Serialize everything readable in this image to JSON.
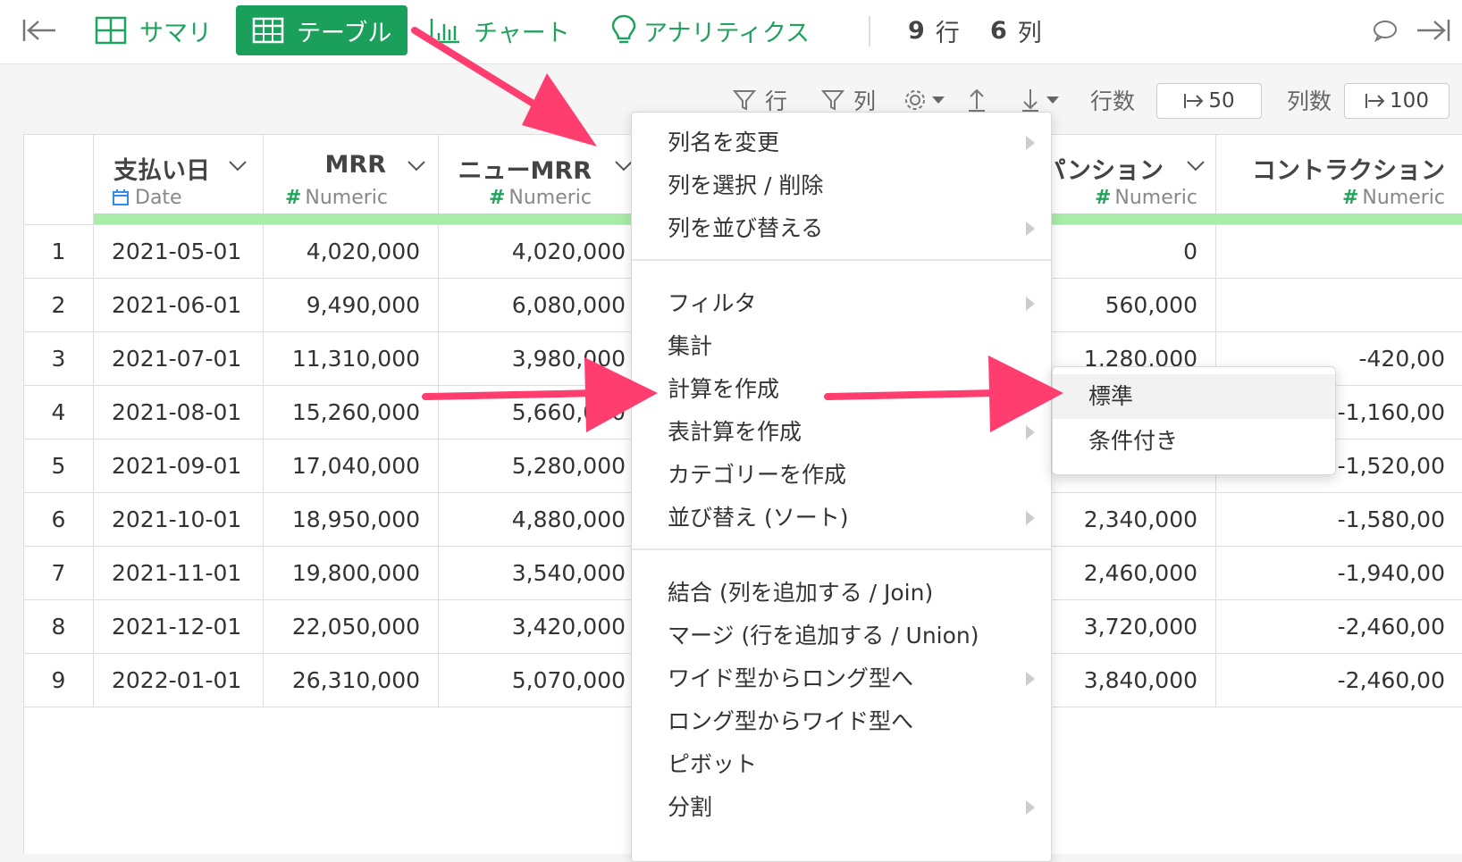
{
  "topbar": {
    "tabs": [
      {
        "label": "サマリ",
        "icon": "grid-icon"
      },
      {
        "label": "テーブル",
        "icon": "table-icon",
        "active": true
      },
      {
        "label": "チャート",
        "icon": "bar-chart-icon"
      },
      {
        "label": "アナリティクス",
        "icon": "lightbulb-icon"
      }
    ],
    "rows_count": "9",
    "rows_label": "行",
    "cols_count": "6",
    "cols_label": "列"
  },
  "toolbar": {
    "filter_rows": "行",
    "filter_cols": "列",
    "rows_label": "行数",
    "rows_value": "50",
    "cols_label": "列数",
    "cols_value": "100"
  },
  "columns": [
    {
      "name": "支払い日",
      "type": "Date"
    },
    {
      "name": "MRR",
      "type": "Numeric"
    },
    {
      "name": "ニューMRR",
      "type": "Numeric"
    },
    {
      "name": "パンション",
      "type": "Numeric"
    },
    {
      "name": "コントラクション",
      "type": "Numeric"
    }
  ],
  "rows": [
    {
      "n": "1",
      "date": "2021-05-01",
      "mrr": "4,020,000",
      "new": "4,020,000",
      "exp": "0",
      "con": ""
    },
    {
      "n": "2",
      "date": "2021-06-01",
      "mrr": "9,490,000",
      "new": "6,080,000",
      "exp": "560,000",
      "con": ""
    },
    {
      "n": "3",
      "date": "2021-07-01",
      "mrr": "11,310,000",
      "new": "3,980,000",
      "exp": "1,280,000",
      "con": "-420,00"
    },
    {
      "n": "4",
      "date": "2021-08-01",
      "mrr": "15,260,000",
      "new": "5,660,000",
      "exp": "",
      "con": "-1,160,00"
    },
    {
      "n": "5",
      "date": "2021-09-01",
      "mrr": "17,040,000",
      "new": "5,280,000",
      "exp": "",
      "con": "-1,520,00"
    },
    {
      "n": "6",
      "date": "2021-10-01",
      "mrr": "18,950,000",
      "new": "4,880,000",
      "exp": "2,340,000",
      "con": "-1,580,00"
    },
    {
      "n": "7",
      "date": "2021-11-01",
      "mrr": "19,800,000",
      "new": "3,540,000",
      "exp": "2,460,000",
      "con": "-1,940,00"
    },
    {
      "n": "8",
      "date": "2021-12-01",
      "mrr": "22,050,000",
      "new": "3,420,000",
      "exp": "3,720,000",
      "con": "-2,460,00"
    },
    {
      "n": "9",
      "date": "2022-01-01",
      "mrr": "26,310,000",
      "new": "5,070,000",
      "exp": "3,840,000",
      "con": "-2,460,00"
    }
  ],
  "menu": {
    "items": [
      {
        "label": "列名を変更",
        "submenu": true
      },
      {
        "label": "列を選択 / 削除",
        "submenu": false
      },
      {
        "label": "列を並び替える",
        "submenu": true
      },
      {
        "label": "フィルタ",
        "submenu": true
      },
      {
        "label": "集計",
        "submenu": false
      },
      {
        "label": "計算を作成",
        "submenu": false
      },
      {
        "label": "表計算を作成",
        "submenu": true
      },
      {
        "label": "カテゴリーを作成",
        "submenu": false
      },
      {
        "label": "並び替え (ソート)",
        "submenu": true
      },
      {
        "label": "結合 (列を追加する / Join)",
        "submenu": false
      },
      {
        "label": "マージ (行を追加する / Union)",
        "submenu": false
      },
      {
        "label": "ワイド型からロング型へ",
        "submenu": true
      },
      {
        "label": "ロング型からワイド型へ",
        "submenu": false
      },
      {
        "label": "ピボット",
        "submenu": false
      },
      {
        "label": "分割",
        "submenu": true
      }
    ]
  },
  "submenu": {
    "items": [
      {
        "label": "標準"
      },
      {
        "label": "条件付き"
      }
    ]
  },
  "colors": {
    "accent": "#1aa05a",
    "arrow": "#ff3d6e",
    "type_bar": "#a9eca8"
  }
}
